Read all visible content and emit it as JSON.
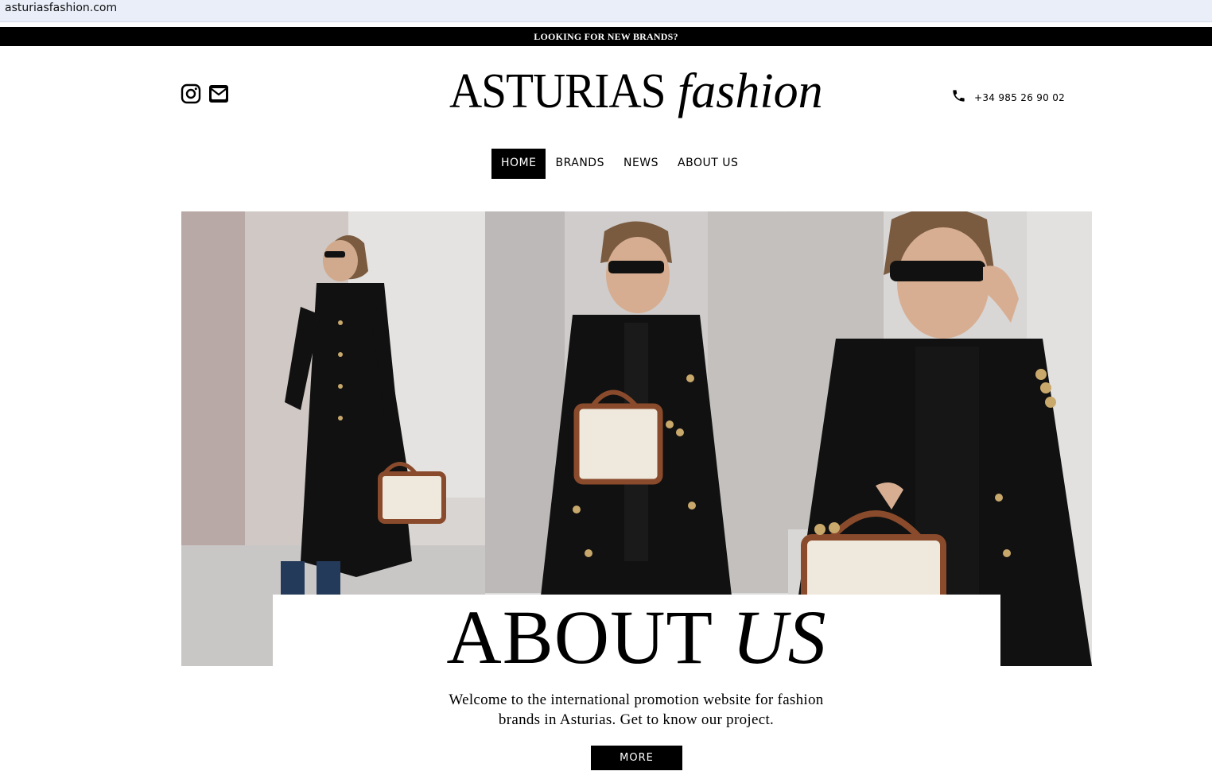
{
  "browser": {
    "url": "asturiasfashion.com"
  },
  "announcement": {
    "text": "LOOKING FOR NEW BRANDS?"
  },
  "header": {
    "social": [
      {
        "icon": "instagram-icon"
      },
      {
        "icon": "envelope-icon"
      }
    ],
    "logo": {
      "main": "ASTURIAS",
      "script": "fashion"
    },
    "phone": {
      "icon": "phone-icon",
      "number": "+34 985 26 90 02"
    }
  },
  "nav": {
    "items": [
      {
        "label": "HOME",
        "active": true
      },
      {
        "label": "BRANDS",
        "active": false
      },
      {
        "label": "NEWS",
        "active": false
      },
      {
        "label": "ABOUT US",
        "active": false
      }
    ]
  },
  "about": {
    "title_main": "ABOUT ",
    "title_italic": "US",
    "text_line1": "Welcome to the international promotion website for fashion",
    "text_line2": "brands in Asturias. Get to know our project.",
    "button": "MORE"
  }
}
